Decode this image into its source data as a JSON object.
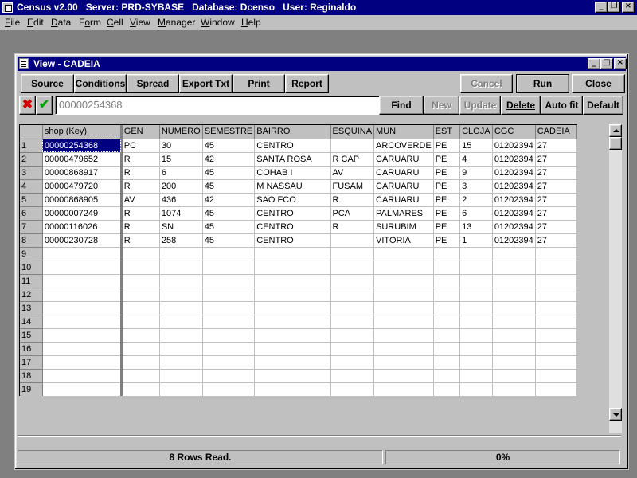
{
  "app": {
    "title": "Census v2.00   Server: PRD-SYBASE   Database: Dcenso   User: Reginaldo",
    "minimize": "_",
    "restore": "❐",
    "close": "×"
  },
  "menu": {
    "items": [
      {
        "label": "File",
        "u": "F",
        "rest": "ile"
      },
      {
        "label": "Edit",
        "u": "E",
        "rest": "dit"
      },
      {
        "label": "Data",
        "u": "D",
        "rest": "ata"
      },
      {
        "label": "Form",
        "pre": "F",
        "u": "o",
        "rest": "rm"
      },
      {
        "label": "Cell",
        "u": "C",
        "rest": "ell"
      },
      {
        "label": "View",
        "u": "V",
        "rest": "iew"
      },
      {
        "label": "Manager",
        "u": "M",
        "rest": "anager"
      },
      {
        "label": "Window",
        "u": "W",
        "rest": "indow"
      },
      {
        "label": "Help",
        "u": "H",
        "rest": "elp"
      }
    ]
  },
  "child": {
    "title": "View - CADEIA",
    "minimize": "_",
    "maximize": "□",
    "close": "×"
  },
  "toolbar": {
    "source": "Source",
    "conditions": "Conditions",
    "spread": "Spread",
    "export": "Export Txt",
    "print": "Print",
    "report": "Report",
    "cancel": "Cancel",
    "run": "Run",
    "close": "Close",
    "find": "Find",
    "new": "New",
    "update": "Update",
    "delete": "Delete",
    "autofit": "Auto fit",
    "default": "Default",
    "reject_icon": "x-icon",
    "accept_icon": "check-icon"
  },
  "key_field": {
    "value": "00000254368"
  },
  "grid": {
    "columns": [
      "shop (Key)",
      "GEN",
      "NUMERO",
      "SEMESTRE",
      "BAIRRO",
      "ESQUINA",
      "MUN",
      "EST",
      "CLOJA",
      "CGC",
      "CADEIA"
    ],
    "rows": [
      [
        "00000254368",
        "PC",
        "30",
        "45",
        "CENTRO",
        "",
        "ARCOVERDE",
        "PE",
        "15",
        "01202394",
        "27"
      ],
      [
        "00000479652",
        "R",
        "15",
        "42",
        "SANTA ROSA",
        "R CAP",
        "CARUARU",
        "PE",
        "4",
        "01202394",
        "27"
      ],
      [
        "00000868917",
        "R",
        "6",
        "45",
        "COHAB I",
        "AV",
        "CARUARU",
        "PE",
        "9",
        "01202394",
        "27"
      ],
      [
        "00000479720",
        "R",
        "200",
        "45",
        "M NASSAU",
        "FUSAM",
        "CARUARU",
        "PE",
        "3",
        "01202394",
        "27"
      ],
      [
        "00000868905",
        "AV",
        "436",
        "42",
        "SAO FCO",
        "R",
        "CARUARU",
        "PE",
        "2",
        "01202394",
        "27"
      ],
      [
        "00000007249",
        "R",
        "1074",
        "45",
        "CENTRO",
        "PCA",
        "PALMARES",
        "PE",
        "6",
        "01202394",
        "27"
      ],
      [
        "00000116026",
        "R",
        "SN",
        "45",
        "CENTRO",
        "R",
        "SURUBIM",
        "PE",
        "13",
        "01202394",
        "27"
      ],
      [
        "00000230728",
        "R",
        "258",
        "45",
        "CENTRO",
        "",
        "VITORIA",
        "PE",
        "1",
        "01202394",
        "27"
      ],
      [
        "",
        "",
        "",
        "",
        "",
        "",
        "",
        "",
        "",
        "",
        ""
      ],
      [
        "",
        "",
        "",
        "",
        "",
        "",
        "",
        "",
        "",
        "",
        ""
      ],
      [
        "",
        "",
        "",
        "",
        "",
        "",
        "",
        "",
        "",
        "",
        ""
      ],
      [
        "",
        "",
        "",
        "",
        "",
        "",
        "",
        "",
        "",
        "",
        ""
      ],
      [
        "",
        "",
        "",
        "",
        "",
        "",
        "",
        "",
        "",
        "",
        ""
      ],
      [
        "",
        "",
        "",
        "",
        "",
        "",
        "",
        "",
        "",
        "",
        ""
      ],
      [
        "",
        "",
        "",
        "",
        "",
        "",
        "",
        "",
        "",
        "",
        ""
      ],
      [
        "",
        "",
        "",
        "",
        "",
        "",
        "",
        "",
        "",
        "",
        ""
      ],
      [
        "",
        "",
        "",
        "",
        "",
        "",
        "",
        "",
        "",
        "",
        ""
      ],
      [
        "",
        "",
        "",
        "",
        "",
        "",
        "",
        "",
        "",
        "",
        ""
      ],
      [
        "",
        "",
        "",
        "",
        "",
        "",
        "",
        "",
        "",
        "",
        ""
      ]
    ],
    "row_numbers": [
      "1",
      "2",
      "3",
      "4",
      "5",
      "6",
      "7",
      "8",
      "9",
      "10",
      "11",
      "12",
      "13",
      "14",
      "15",
      "16",
      "17",
      "18",
      "19"
    ]
  },
  "status": {
    "message": "8 Rows Read.",
    "progress": "0%"
  }
}
